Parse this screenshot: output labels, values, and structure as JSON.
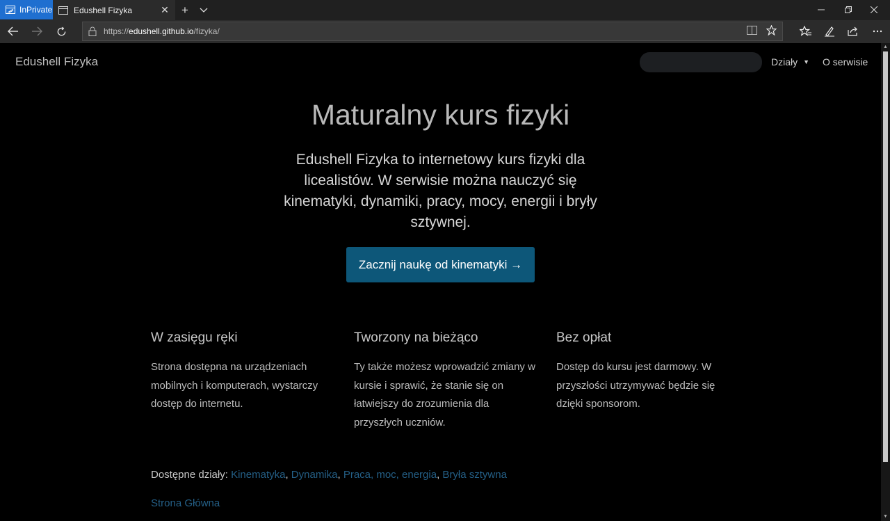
{
  "browser": {
    "inprivate_label": "InPrivate",
    "tab_title": "Edushell Fizyka",
    "url_prefix": "https://",
    "url_host": "edushell.github.io",
    "url_path": "/fizyka/"
  },
  "site": {
    "brand": "Edushell Fizyka",
    "nav_dzialy": "Działy",
    "nav_about": "O serwisie"
  },
  "hero": {
    "title": "Maturalny kurs fizyki",
    "lead": "Edushell Fizyka to internetowy kurs fizyki dla licealistów. W serwisie można nauczyć się kinematyki, dynamiki, pracy, mocy, energii i bryły sztywnej.",
    "cta_label": "Zacznij naukę od kinematyki →"
  },
  "features": [
    {
      "title": "W zasięgu ręki",
      "text": "Strona dostępna na urządzeniach mobilnych i komputerach, wystarczy dostęp do internetu."
    },
    {
      "title": "Tworzony na bieżąco",
      "text": "Ty także możesz wprowadzić zmiany w kursie i sprawić, że stanie się on łatwiejszy do zrozumienia dla przyszłych uczniów."
    },
    {
      "title": "Bez opłat",
      "text": "Dostęp do kursu jest darmowy. W przyszłości utrzymywać będzie się dzięki sponsorom."
    }
  ],
  "sections": {
    "label": "Dostępne działy:",
    "links": [
      "Kinematyka",
      "Dynamika",
      "Praca, moc, energia",
      "Bryła sztywna"
    ],
    "separator": ", "
  },
  "footer": {
    "home_link": "Strona Główna"
  },
  "colors": {
    "link": "#245f86",
    "cta_bg": "#0d5779",
    "inprivate_badge": "#1f6fd0"
  }
}
